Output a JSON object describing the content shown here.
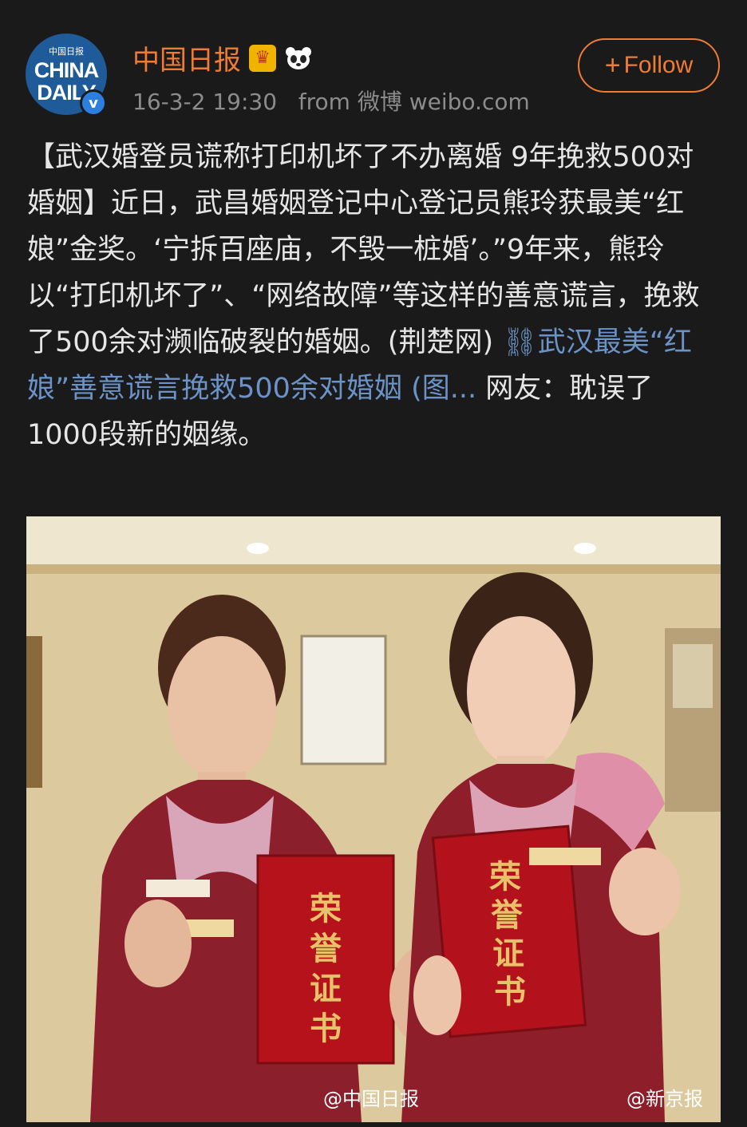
{
  "account": {
    "avatar_small": "中国日报",
    "avatar_big_1": "CHINA",
    "avatar_big_2": "DAILY",
    "verified_mark": "v",
    "name": "中国日报",
    "badge_crown_icon": "crown-icon",
    "badge_panda_icon": "panda-icon",
    "timestamp": "16-3-2 19:30",
    "source": "from 微博 weibo.com"
  },
  "follow": {
    "plus": "+",
    "label": "Follow"
  },
  "post": {
    "text_before_link": "【武汉婚登员谎称打印机坏了不办离婚 9年挽救500对婚姻】近日，武昌婚姻登记中心登记员熊玲获最美“红娘”金奖。‘宁拆百座庙，不毁一桩婚’。”9年来，熊玲以“打印机坏了”、“网络故障”等这样的善意谎言，挽救了500余对濒临破裂的婚姻。(荆楚网) ",
    "link_icon": "link-icon",
    "link_text": "武汉最美“红娘”善意谎言挽救500余对婚姻 (图...",
    "text_after_link": " 网友：耽误了1000段新的姻缘。"
  },
  "photo": {
    "cert_left": [
      "荣",
      "誉",
      "证",
      "书"
    ],
    "cert_right": [
      "荣",
      "誉",
      "证",
      "书"
    ],
    "watermark_left": "@中国日报",
    "watermark_right": "@新京报"
  },
  "colors": {
    "background": "#1a1a1a",
    "accent_orange": "#f07c34",
    "link_blue": "#6c93c8",
    "meta_gray": "#8c8c8c"
  }
}
